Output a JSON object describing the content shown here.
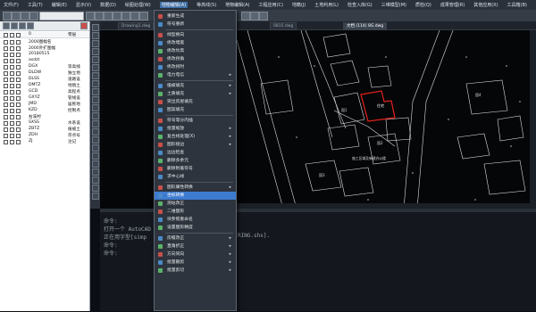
{
  "menubar": {
    "items": [
      {
        "label": "文件(F)"
      },
      {
        "label": "工具(T)"
      },
      {
        "label": "编辑(E)"
      },
      {
        "label": "显示(V)"
      },
      {
        "label": "数据(D)"
      },
      {
        "label": "绘图处理(W)"
      },
      {
        "label": "地物编辑(A)",
        "active": true
      },
      {
        "label": "等高线(S)"
      },
      {
        "label": "地物编辑(A)"
      },
      {
        "label": "工程应用(C)"
      },
      {
        "label": "地籍(J)"
      },
      {
        "label": "土地利用(L)"
      },
      {
        "label": "检查入库(G)"
      },
      {
        "label": "三维模型(M)"
      },
      {
        "label": "质检(Q)"
      },
      {
        "label": "成果管理(R)"
      },
      {
        "label": "其他应用(X)"
      },
      {
        "label": "工具箱(B)"
      },
      {
        "label": "云协同(Y)"
      }
    ]
  },
  "toolbar": {
    "dropdown_value": ""
  },
  "layers": {
    "header": {
      "name": "0",
      "desc": "零层"
    },
    "rows": [
      {
        "name": "2000图幅名",
        "desc": ""
      },
      {
        "name": "2000外扩图幅",
        "desc": ""
      },
      {
        "name": "20180515",
        "desc": ""
      },
      {
        "name": "asdzt",
        "desc": ""
      },
      {
        "name": "DGX",
        "desc": "等高线"
      },
      {
        "name": "DLDW",
        "desc": "独立地"
      },
      {
        "name": "DLSS",
        "desc": "道路设"
      },
      {
        "name": "DMTZ",
        "desc": "地貌土"
      },
      {
        "name": "GCD",
        "desc": "高程点"
      },
      {
        "name": "GXYZ",
        "desc": "管线设"
      },
      {
        "name": "JMD",
        "desc": "居民地"
      },
      {
        "name": "KZD",
        "desc": "控制点"
      },
      {
        "name": "右溪村",
        "desc": ""
      },
      {
        "name": "SXSS",
        "desc": "水系设"
      },
      {
        "name": "ZBTZ",
        "desc": "植被土"
      },
      {
        "name": "ZDH",
        "desc": "宗点号"
      },
      {
        "name": "ZJ",
        "desc": "注记"
      }
    ]
  },
  "tabs": [
    {
      "label": "Drawing1.dwg"
    },
    {
      "label": "0815.dwg"
    },
    {
      "label": "文档 (114) 8G.dwg",
      "active": true
    }
  ],
  "canvas": {
    "parcel_labels": [
      "国1",
      "国2",
      "国3",
      "国4"
    ],
    "selected_label": "住宅",
    "annotation": "施工区域及新建办公楼"
  },
  "dropdown": {
    "items": [
      {
        "label": "重新生成",
        "arrow": false
      },
      {
        "label": "符号重新",
        "arrow": false
      },
      {
        "sep": true
      },
      {
        "label": "线型换向",
        "arrow": false
      },
      {
        "label": "修改墙宽",
        "arrow": false
      },
      {
        "label": "修改坎高",
        "arrow": false
      },
      {
        "label": "修改拐角",
        "arrow": false
      },
      {
        "label": "修改拐时",
        "arrow": false
      },
      {
        "label": "电力电信",
        "arrow": true
      },
      {
        "sep": true
      },
      {
        "label": "植被填充",
        "arrow": true
      },
      {
        "label": "土质填充",
        "arrow": true
      },
      {
        "label": "突出房屋填充",
        "arrow": false
      },
      {
        "label": "图案填充",
        "arrow": false
      },
      {
        "sep": true
      },
      {
        "label": "符号等分内插",
        "arrow": false
      },
      {
        "label": "批量缩放",
        "arrow": true
      },
      {
        "label": "复合线处理(X)",
        "arrow": true
      },
      {
        "label": "图形接边",
        "arrow": true
      },
      {
        "label": "边边检查",
        "arrow": false
      },
      {
        "label": "删除多余元",
        "arrow": false
      },
      {
        "label": "删除附着符号",
        "arrow": false
      },
      {
        "label": "求中心线",
        "arrow": false
      },
      {
        "sep": true
      },
      {
        "label": "图形属性转换",
        "arrow": true
      },
      {
        "label": "坐标转换",
        "arrow": false,
        "highlight": true
      },
      {
        "label": "测站改正",
        "arrow": false
      },
      {
        "label": "二维图形",
        "arrow": false
      },
      {
        "label": "块参照重命名",
        "arrow": false
      },
      {
        "label": "设置图形精度",
        "arrow": false
      },
      {
        "sep": true
      },
      {
        "label": "房檐改正",
        "arrow": true
      },
      {
        "label": "直角折正",
        "arrow": true
      },
      {
        "label": "方向同向",
        "arrow": true
      },
      {
        "label": "批量删剪",
        "arrow": true
      },
      {
        "label": "批量剪切",
        "arrow": true
      }
    ]
  },
  "command": {
    "lines": [
      "命令:",
      "打开一个 AutoCAD",
      "正在用字型[simp",
      "命令:",
      "命令:"
    ],
    "tail": "RING.shx]."
  },
  "colors": {
    "selected": "#e8221b",
    "menu_highlight": "#3d7bd0"
  }
}
